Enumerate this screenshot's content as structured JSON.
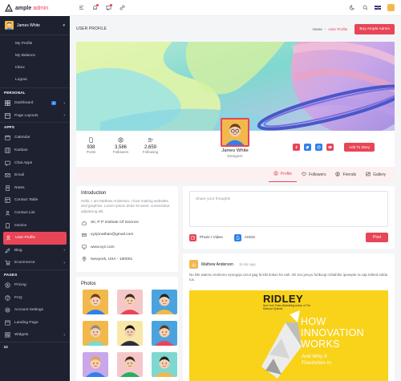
{
  "brand": {
    "name_bold": "ample",
    "name_light": "admin"
  },
  "sidebar": {
    "user": {
      "name": "James White"
    },
    "user_links": [
      "My Profile",
      "My Balance",
      "Inbox",
      "Logout"
    ],
    "personal_title": "PERSONAL",
    "dashboard": {
      "label": "Dashboard",
      "badge": "5"
    },
    "page_layouts": {
      "label": "Page Layouts"
    },
    "apps_title": "APPS",
    "apps": [
      {
        "label": "Calendar",
        "icon": "calendar-icon"
      },
      {
        "label": "Kanban",
        "icon": "kanban-icon"
      },
      {
        "label": "Chat Apps",
        "icon": "chat-icon"
      },
      {
        "label": "Email",
        "icon": "mail-icon"
      },
      {
        "label": "Notes",
        "icon": "notes-icon"
      },
      {
        "label": "Contact Table",
        "icon": "contact-table-icon"
      },
      {
        "label": "Contact List",
        "icon": "contact-list-icon"
      },
      {
        "label": "Invoice",
        "icon": "invoice-icon"
      },
      {
        "label": "User Profile",
        "icon": "user-icon"
      },
      {
        "label": "Blog",
        "icon": "blog-icon"
      },
      {
        "label": "Ecommerce",
        "icon": "cart-icon"
      }
    ],
    "pages_title": "PAGES",
    "pages": [
      {
        "label": "Pricing",
        "icon": "pricing-icon"
      },
      {
        "label": "FAQ",
        "icon": "faq-icon"
      },
      {
        "label": "Account Settings",
        "icon": "settings-icon"
      },
      {
        "label": "Landing Page",
        "icon": "landing-icon"
      },
      {
        "label": "Widgets",
        "icon": "widgets-icon"
      }
    ],
    "ui_title": "UI"
  },
  "page": {
    "title": "USER PROFILE",
    "breadcrumb_home": "Home",
    "breadcrumb_sep": "›",
    "breadcrumb_current": "User Profile",
    "buy_button": "Buy Ample Admin"
  },
  "profile": {
    "stats": [
      {
        "value": "938",
        "label": "Posts"
      },
      {
        "value": "3,586",
        "label": "Followers"
      },
      {
        "value": "2,659",
        "label": "Following"
      }
    ],
    "name": "James White",
    "role": "Designer",
    "add_story": "Add To Story",
    "tabs": [
      "Profile",
      "Followers",
      "Friends",
      "Gallery"
    ]
  },
  "intro": {
    "title": "Introduction",
    "text": "Hello, I am Mathew Anderson. I love making websites and graphics. Lorem ipsum dolor sit amet, consectetur adipiscing elit.",
    "school": "Sir, P P Institute Of Science",
    "email": "xyzjonathan@gmail.com",
    "website": "www.xyz.com",
    "location": "Newyork, USA - 100001"
  },
  "photos": {
    "title": "Photos"
  },
  "composer": {
    "placeholder": "Share your thoughts",
    "photo_video": "Photo / Video",
    "article": "Article",
    "post": "Post"
  },
  "post": {
    "author": "Mathew Anderson",
    "time": "15 min ago",
    "text": "Nu kile wakmu mokruno eyongojo urzot gag fa kiki kokun he nah. Wi zeo pevyu furtkoup rohiahihe ipavepte ra vap tebted edidu tux.",
    "book_title": "RIDLEY",
    "book_sub": "New York Times Bestselling Author of The Rational Optimist",
    "book_big": [
      "HOW",
      "INNOVATION",
      "WORKS"
    ],
    "book_small": [
      "And Why It",
      "Flourishes in"
    ]
  }
}
